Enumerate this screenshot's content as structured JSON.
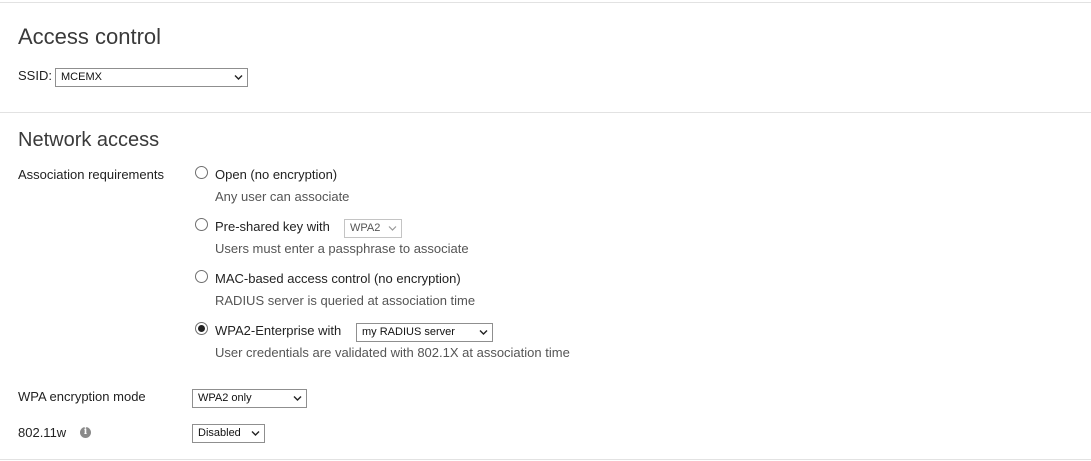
{
  "access_control": {
    "title": "Access control",
    "ssid_label": "SSID:",
    "ssid_value": "MCEMX"
  },
  "network_access": {
    "title": "Network access",
    "association_label": "Association requirements",
    "options": [
      {
        "label": "Open (no encryption)",
        "description": "Any user can associate",
        "selected": false
      },
      {
        "label": "Pre-shared key with",
        "select_value": "WPA2",
        "description": "Users must enter a passphrase to associate",
        "selected": false
      },
      {
        "label": "MAC-based access control (no encryption)",
        "description": "RADIUS server is queried at association time",
        "selected": false
      },
      {
        "label": "WPA2-Enterprise with",
        "select_value": "my RADIUS server",
        "description": "User credentials are validated with 802.1X at association time",
        "selected": true
      }
    ],
    "wpa_mode_label": "WPA encryption mode",
    "wpa_mode_value": "WPA2 only",
    "dot11w_label": "802.11w",
    "dot11w_value": "Disabled"
  }
}
